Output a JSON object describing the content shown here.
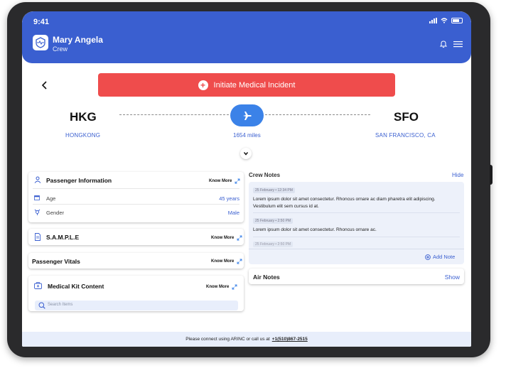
{
  "status": {
    "time": "9:41"
  },
  "header": {
    "name": "Mary Angela",
    "role": "Crew"
  },
  "incident": {
    "label": "Initiate Medical Incident"
  },
  "route": {
    "origin_code": "HKG",
    "origin_city": "HONGKONG",
    "dest_code": "SFO",
    "dest_city": "SAN FRANCISCO, CA",
    "distance": "1654 miles"
  },
  "passenger": {
    "title": "Passenger Information",
    "know_more": "Know More",
    "age_label": "Age",
    "age_value": "45 years",
    "gender_label": "Gender",
    "gender_value": "Male"
  },
  "sample": {
    "title": "S.A.M.P.L.E",
    "know_more": "Know More"
  },
  "vitals": {
    "title": "Passenger Vitals",
    "know_more": "Know More"
  },
  "kit": {
    "title": "Medical Kit Content",
    "know_more": "Know More",
    "search_placeholder": "Search Items"
  },
  "crew_notes": {
    "title": "Crew Notes",
    "hide": "Hide",
    "notes": [
      {
        "date": "25 February • 12:34 PM",
        "text": "Lorem ipsum dolor sit amet consectetur. Rhoncus ornare ac diam pharetra elit adipiscing. Vestibulum elit sem cursus id at."
      },
      {
        "date": "25 February • 2:50 PM",
        "text": "Lorem ipsum dolor sit amet consectetur. Rhoncus ornare ac."
      },
      {
        "date": "25 February • 2:50 PM",
        "text": ""
      }
    ],
    "add_note": "Add Note"
  },
  "air_notes": {
    "title": "Air Notes",
    "show": "Show"
  },
  "footer": {
    "text": "Please connect using ARINC or call us at",
    "phone": "+1(510)867-2515"
  },
  "colors": {
    "brand": "#3a5fd0",
    "danger": "#ef4c4c",
    "accent": "#3b82e8"
  }
}
